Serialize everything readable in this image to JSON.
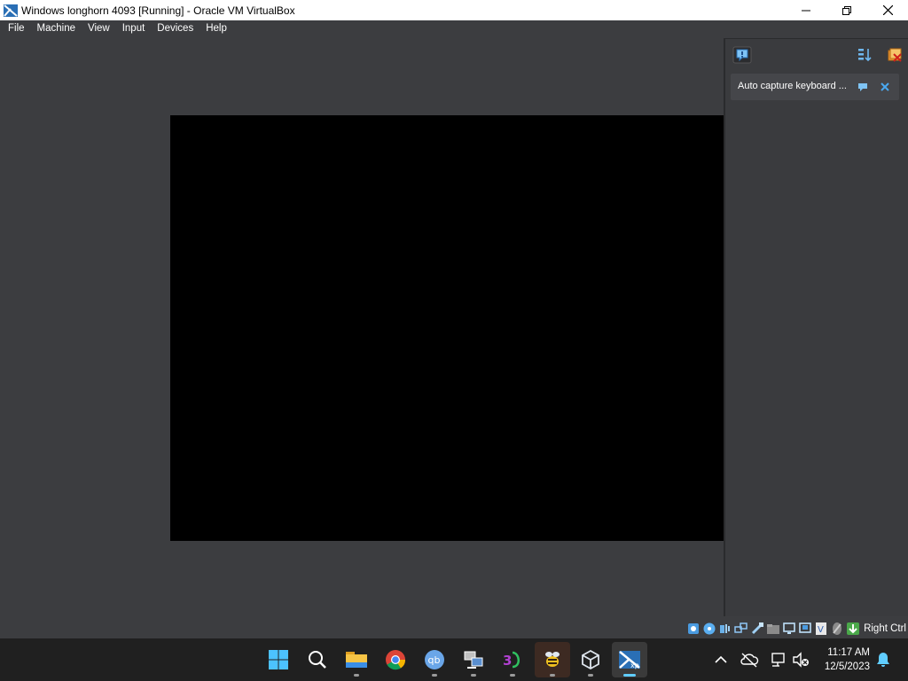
{
  "window": {
    "title": "Windows longhorn 4093 [Running] - Oracle VM VirtualBox"
  },
  "menu": {
    "items": [
      "File",
      "Machine",
      "View",
      "Input",
      "Devices",
      "Help"
    ]
  },
  "notification_panel": {
    "message": "Auto capture keyboard ..."
  },
  "statusbar": {
    "host_key": "Right Ctrl"
  },
  "taskbar": {
    "apps": [
      "start-icon",
      "search-icon",
      "file-explorer-icon",
      "chrome-icon",
      "qbittorrent-icon",
      "remote-desktop-icon",
      "3d-app-icon",
      "bee-app-icon",
      "virtualbox-icon",
      "windows-xp-vm-icon"
    ],
    "time": "11:17 AM",
    "date": "12/5/2023"
  },
  "colors": {
    "vm_background": "#3c3d40",
    "vm_screen": "#000000",
    "taskbar": "#202020",
    "active_indicator": "#60cdff"
  }
}
